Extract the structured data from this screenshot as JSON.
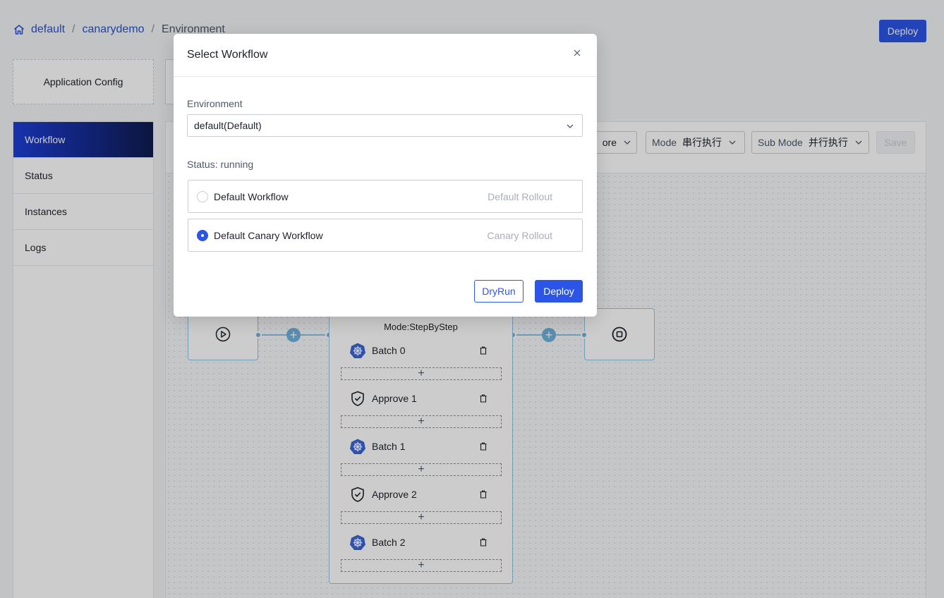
{
  "breadcrumb": {
    "items": [
      "default",
      "canarydemo",
      "Environment"
    ],
    "separator": "/"
  },
  "header": {
    "deploy_label": "Deploy"
  },
  "left_panel": {
    "app_config_label": "Application Config",
    "menu": [
      "Workflow",
      "Status",
      "Instances",
      "Logs"
    ],
    "active_item": "Workflow"
  },
  "toolbar": {
    "partial_select_value": "ore",
    "mode_label": "Mode",
    "mode_value": "串行执行",
    "sub_mode_label": "Sub Mode",
    "sub_mode_value": "并行执行",
    "save_label": "Save"
  },
  "canvas": {
    "group_mode": "Mode:StepByStep",
    "steps": [
      {
        "name": "Batch 0",
        "icon": "kubernetes-icon"
      },
      {
        "name": "Approve 1",
        "icon": "shield-check-icon"
      },
      {
        "name": "Batch 1",
        "icon": "kubernetes-icon"
      },
      {
        "name": "Approve 2",
        "icon": "shield-check-icon"
      },
      {
        "name": "Batch 2",
        "icon": "kubernetes-icon"
      }
    ],
    "add_symbol": "+"
  },
  "dialog": {
    "title": "Select Workflow",
    "environment_label": "Environment",
    "environment_value": "default(Default)",
    "status_text": "Status: running",
    "options": [
      {
        "name": "Default Workflow",
        "description": "Default Rollout",
        "selected": false
      },
      {
        "name": "Default Canary Workflow",
        "description": "Canary Rollout",
        "selected": true
      }
    ],
    "dryrun_label": "DryRun",
    "deploy_label": "Deploy"
  },
  "colors": {
    "primary": "#2c55e8",
    "active_menu_start": "#1d3fd8",
    "active_menu_end": "#0f1b4d",
    "node_border": "#90c5e5"
  }
}
